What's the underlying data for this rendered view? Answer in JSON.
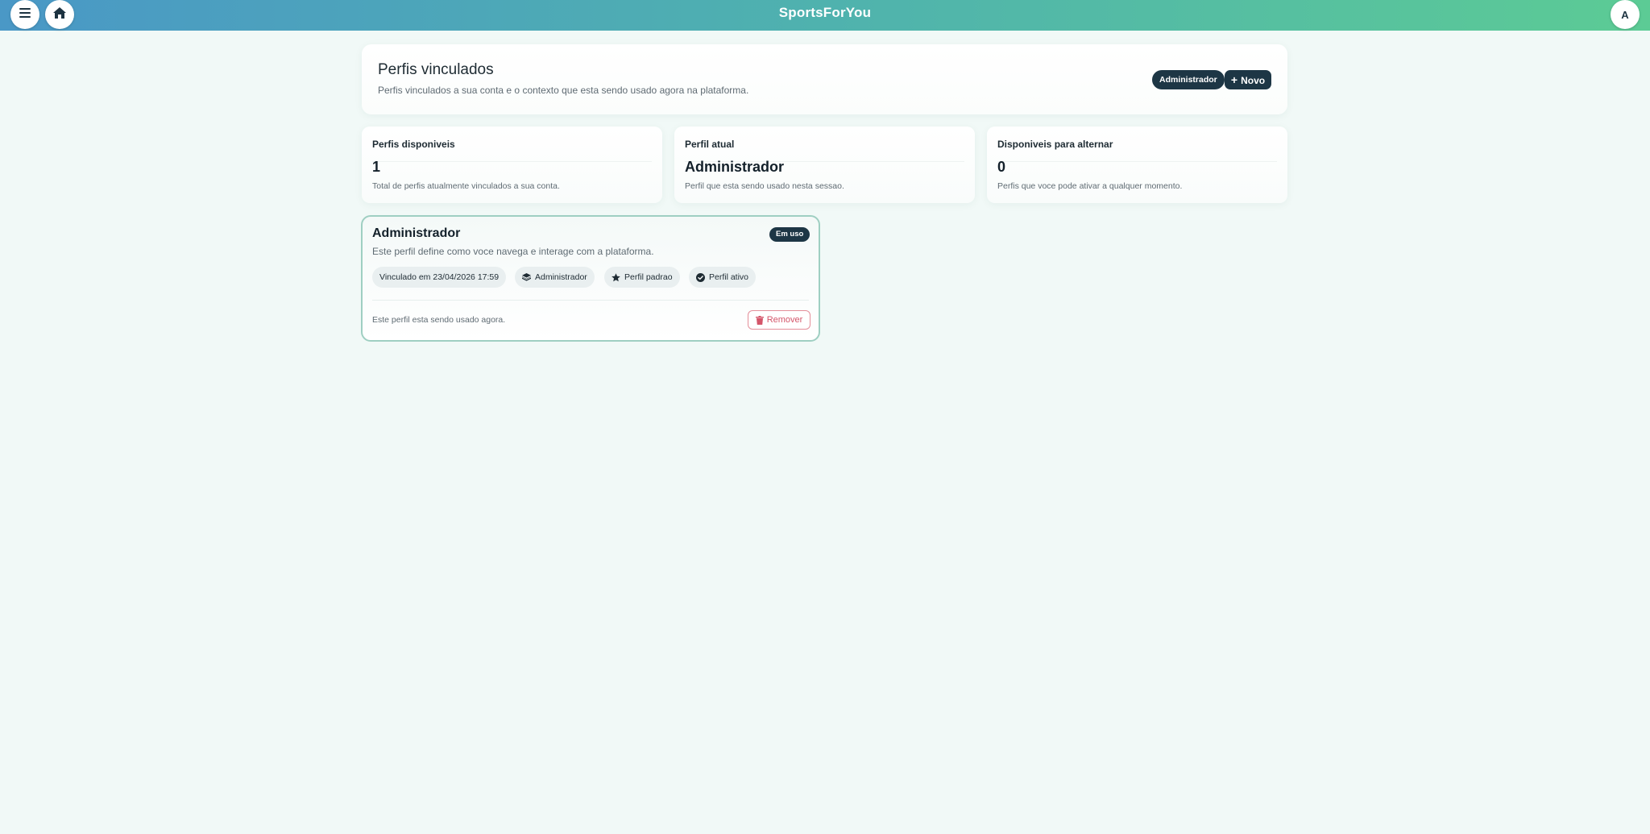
{
  "app": {
    "title": "SportsForYou",
    "user_initial": "A"
  },
  "header": {
    "title": "Perfis vinculados",
    "subtitle": "Perfis vinculados a sua conta e o contexto que esta sendo usado agora na plataforma.",
    "role_pill": "Administrador",
    "new_button": "Novo"
  },
  "stats": [
    {
      "label": "Perfis disponiveis",
      "value": "1",
      "description": "Total de perfis atualmente vinculados a sua conta."
    },
    {
      "label": "Perfil atual",
      "value": "Administrador",
      "description": "Perfil que esta sendo usado nesta sessao."
    },
    {
      "label": "Disponiveis para alternar",
      "value": "0",
      "description": "Perfis que voce pode ativar a qualquer momento."
    }
  ],
  "profile": {
    "name": "Administrador",
    "badge": "Em uso",
    "description": "Este perfil define como voce navega e interage com a plataforma.",
    "chips": [
      {
        "label": "Vinculado em 23/04/2026 17:59",
        "icon": ""
      },
      {
        "label": "Administrador",
        "icon": "layers-icon"
      },
      {
        "label": "Perfil padrao",
        "icon": "star-icon"
      },
      {
        "label": "Perfil ativo",
        "icon": "check-circle-icon"
      }
    ],
    "footer": "Este perfil esta sendo usado agora.",
    "remove_button": "Remover"
  },
  "colors": {
    "topbar_start": "#4a98c6",
    "topbar_end": "#5ccb95",
    "dark_accent": "#1d3645",
    "danger": "#d4566a",
    "background": "#f1f9f7"
  }
}
